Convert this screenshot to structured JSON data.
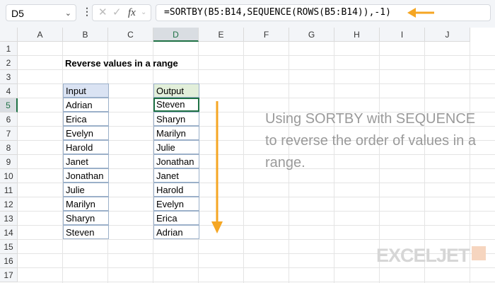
{
  "name_box": "D5",
  "formula": "=SORTBY(B5:B14,SEQUENCE(ROWS(B5:B14)),-1)",
  "fx_label": "fx",
  "columns": [
    "A",
    "B",
    "C",
    "D",
    "E",
    "F",
    "G",
    "H",
    "I",
    "J"
  ],
  "rows": [
    "1",
    "2",
    "3",
    "4",
    "5",
    "6",
    "7",
    "8",
    "9",
    "10",
    "11",
    "12",
    "13",
    "14",
    "15",
    "16",
    "17"
  ],
  "title": "Reverse values in a range",
  "input_header": "Input",
  "input": [
    "Adrian",
    "Erica",
    "Evelyn",
    "Harold",
    "Janet",
    "Jonathan",
    "Julie",
    "Marilyn",
    "Sharyn",
    "Steven"
  ],
  "output_header": "Output",
  "output": [
    "Steven",
    "Sharyn",
    "Marilyn",
    "Julie",
    "Jonathan",
    "Janet",
    "Harold",
    "Evelyn",
    "Erica",
    "Adrian"
  ],
  "note": "Using SORTBY with SEQUENCE to reverse the order of values in a range.",
  "logo": "EXCELJET",
  "colors": {
    "accent_arrow": "#f5a623",
    "input_header_bg": "#dae3f3",
    "output_header_bg": "#e2efda",
    "selection": "#1e7145"
  }
}
